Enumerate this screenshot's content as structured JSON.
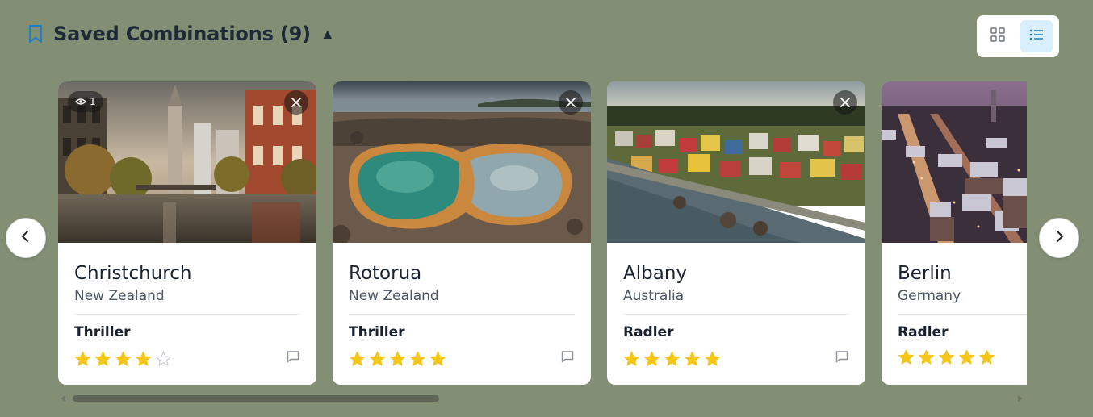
{
  "header": {
    "title": "Saved Combinations (9)",
    "caret": "▲",
    "icon": "bookmark-icon"
  },
  "view_toggle": {
    "grid_icon": "grid-icon",
    "list_icon": "list-icon",
    "active": "list"
  },
  "carousel": {
    "prev_icon": "chevron-left-icon",
    "next_icon": "chevron-right-icon",
    "cards": [
      {
        "city": "Christchurch",
        "country": "New Zealand",
        "beer": "Thriller",
        "rating": 4,
        "views": "1",
        "image": "canal-street-photo"
      },
      {
        "city": "Rotorua",
        "country": "New Zealand",
        "beer": "Thriller",
        "rating": 5,
        "image": "geothermal-pool-photo"
      },
      {
        "city": "Albany",
        "country": "Australia",
        "beer": "Radler",
        "rating": 5,
        "image": "coastal-town-photo"
      },
      {
        "city": "Berlin",
        "country": "Germany",
        "beer": "Radler",
        "rating": 5,
        "image": "city-night-photo"
      }
    ]
  },
  "colors": {
    "background": "#838f75",
    "star": "#f5c518",
    "active_toggle": "#d7efff",
    "bookmark": "#1d7fc4"
  }
}
